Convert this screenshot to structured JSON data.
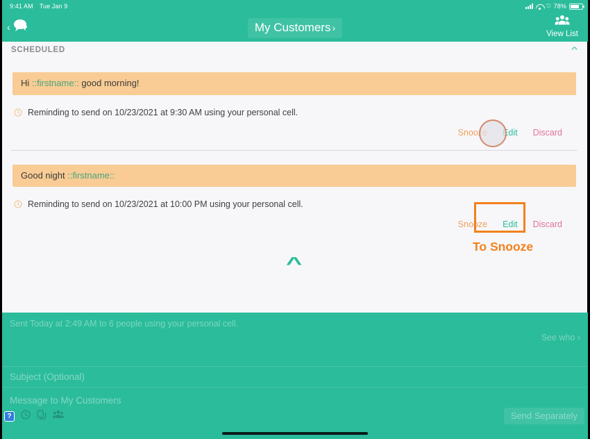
{
  "status_bar": {
    "time": "9:41 AM",
    "date": "Tue Jan 9",
    "battery_percent": "78%",
    "signal_icon": "cellular-signal-icon",
    "wifi_icon": "wifi-icon",
    "lock_icon": "rotation-lock-icon",
    "battery_icon": "battery-icon"
  },
  "nav": {
    "back_icon": "back-chevron-icon",
    "messages_icon": "chat-bubble-icon",
    "title": "My Customers",
    "title_chevron": "›",
    "view_list_icon": "group-people-icon",
    "view_list_label": "View List"
  },
  "panel": {
    "section_title": "SCHEDULED",
    "collapse_icon": "chevron-up-icon",
    "bottom_collapse_icon": "chevron-up-large-icon",
    "items": [
      {
        "message_prefix": "Hi ",
        "message_token": "::firstname::",
        "message_suffix": " good morning!",
        "reminder_icon": "clock-icon",
        "reminder": "Reminding to send on 10/23/2021 at 9:30 AM using your personal cell.",
        "actions": {
          "snooze": "Snooze",
          "edit": "Edit",
          "discard": "Discard"
        }
      },
      {
        "message_prefix": "Good night ",
        "message_token": "::firstname::",
        "message_suffix": "",
        "reminder_icon": "clock-icon",
        "reminder": "Reminding to send on 10/23/2021 at 10:00 PM using your personal cell.",
        "actions": {
          "snooze": "Snooze",
          "edit": "Edit",
          "discard": "Discard"
        }
      }
    ]
  },
  "annotations": {
    "cursor_circle": "cursor-highlight-circle",
    "highlight_box": "snooze-highlight-box",
    "label": "To Snooze",
    "color": "#F2811D"
  },
  "compose": {
    "sent_status": "Sent Today at 2:49 AM to 6 people using your personal cell.",
    "see_who_label": "See who ›",
    "subject_placeholder": "Subject (Optional)",
    "message_placeholder": "Message to My Customers",
    "toolbar": {
      "help_label": "?",
      "schedule_icon": "clock-schedule-icon",
      "template_icon": "copy-template-icon",
      "recipients_icon": "group-people-icon"
    },
    "send_button": "Send Separately"
  },
  "colors": {
    "brand_teal": "#2BBC9B",
    "bubble_amber": "#F8CC94",
    "panel_bg": "#F7F7FA",
    "snooze": "#F0A05A",
    "edit": "#2BBC9B",
    "discard": "#E2719A",
    "annotation_orange": "#F2811D"
  }
}
